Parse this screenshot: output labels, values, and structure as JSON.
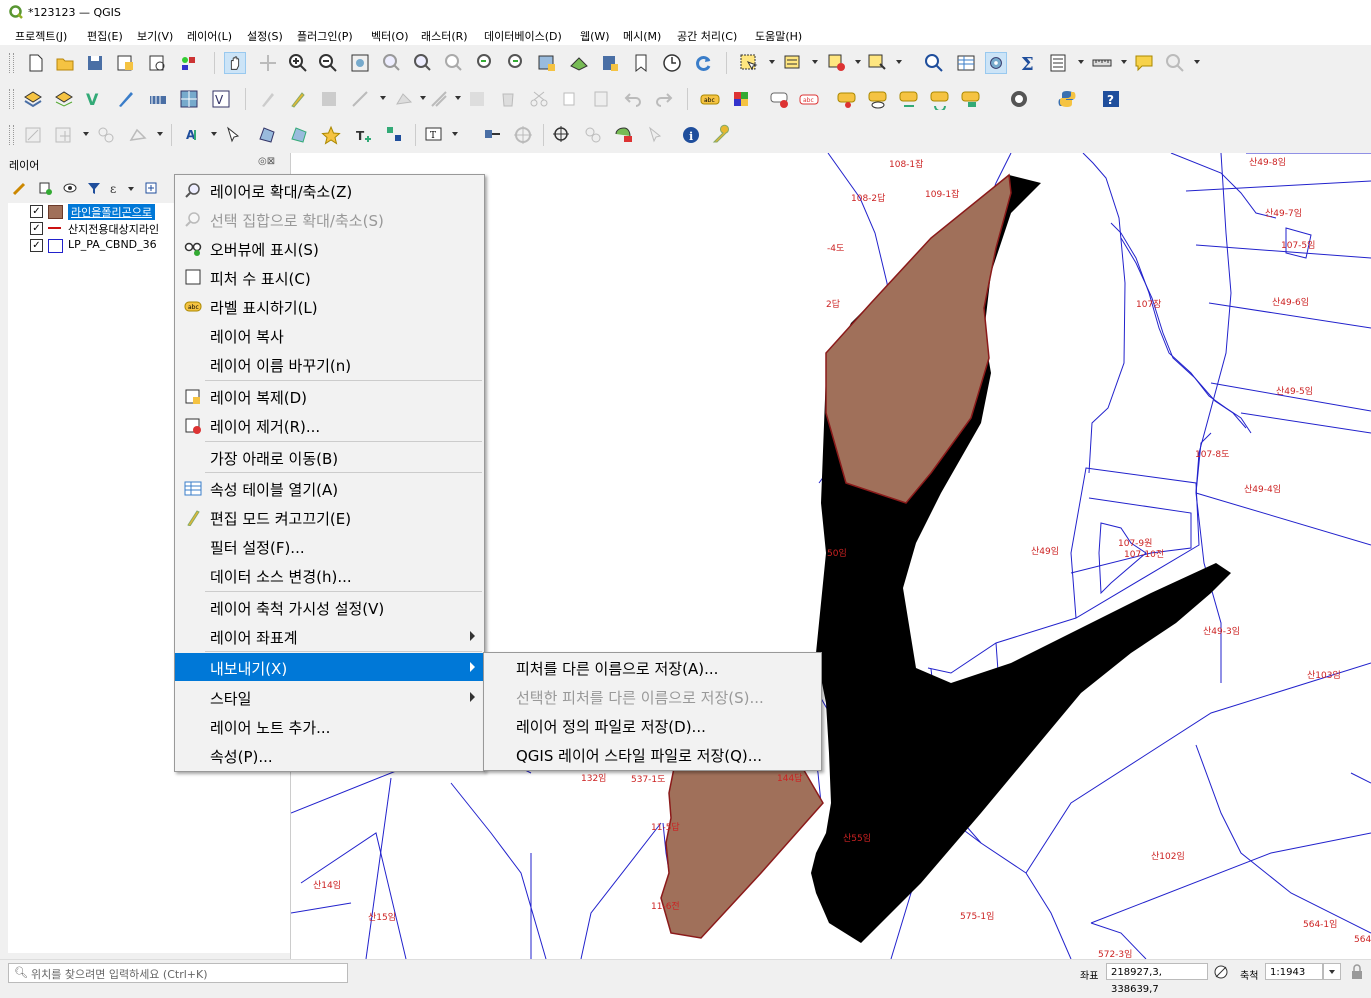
{
  "window": {
    "title": "*123123 — QGIS"
  },
  "menubar": [
    "프로젝트(J)",
    "편집(E)",
    "보기(V)",
    "레이어(L)",
    "설정(S)",
    "플러그인(P)",
    "벡터(O)",
    "래스터(R)",
    "데이터베이스(D)",
    "웹(W)",
    "메시(M)",
    "공간 처리(C)",
    "도움말(H)"
  ],
  "layers_panel": {
    "title": "레이어",
    "buttons": "◎⊠",
    "layers": [
      {
        "name": "라인을폴리곤으로",
        "checked": "✓",
        "symbol": "fill",
        "color": "#a0705a",
        "selected": true
      },
      {
        "name": "산지전용대상지라인",
        "checked": "✓",
        "symbol": "line",
        "color": "#cc1111",
        "selected": false
      },
      {
        "name": "LP_PA_CBND_36",
        "checked": "✓",
        "symbol": "outline",
        "color": "#2222cc",
        "selected": false
      }
    ]
  },
  "context_menu": {
    "items": [
      {
        "label": "레이어로 확대/축소(Z)",
        "icon": "zoom-layer-icon",
        "disabled": false
      },
      {
        "label": "선택 집합으로 확대/축소(S)",
        "icon": "zoom-selection-icon",
        "disabled": true
      },
      {
        "label": "오버뷰에 표시(S)",
        "icon": "overview-icon",
        "disabled": false
      },
      {
        "label": "피처 수 표시(C)",
        "icon": "checkbox-icon",
        "disabled": false
      },
      {
        "label": "라벨 표시하기(L)",
        "icon": "label-icon",
        "disabled": false
      },
      {
        "label": "레이어 복사",
        "icon": "",
        "disabled": false
      },
      {
        "label": "레이어 이름 바꾸기(n)",
        "icon": "",
        "disabled": false
      },
      {
        "label": "레이어 복제(D)",
        "icon": "duplicate-layer-icon",
        "disabled": false
      },
      {
        "label": "레이어 제거(R)...",
        "icon": "remove-layer-icon",
        "disabled": false
      },
      {
        "label": "가장 아래로 이동(B)",
        "icon": "",
        "disabled": false
      },
      {
        "label": "속성 테이블 열기(A)",
        "icon": "attribute-table-icon",
        "disabled": false
      },
      {
        "label": "편집 모드 켜고끄기(E)",
        "icon": "pencil-icon",
        "disabled": false
      },
      {
        "label": "필터 설정(F)...",
        "icon": "",
        "disabled": false
      },
      {
        "label": "데이터 소스 변경(h)...",
        "icon": "",
        "disabled": false
      },
      {
        "label": "레이어 축척 가시성 설정(V)",
        "icon": "",
        "disabled": false
      },
      {
        "label": "레이어 좌표계",
        "icon": "",
        "disabled": false,
        "submenu": true
      },
      {
        "label": "내보내기(X)",
        "icon": "",
        "disabled": false,
        "submenu": true,
        "highlighted": true
      },
      {
        "label": "스타일",
        "icon": "",
        "disabled": false,
        "submenu": true
      },
      {
        "label": "레이어 노트 추가...",
        "icon": "",
        "disabled": false
      },
      {
        "label": "속성(P)...",
        "icon": "",
        "disabled": false
      }
    ]
  },
  "export_submenu": {
    "items": [
      {
        "label": "피처를 다른 이름으로 저장(A)...",
        "disabled": false
      },
      {
        "label": "선택한 피처를 다른 이름으로 저장(S)...",
        "disabled": true
      },
      {
        "label": "레이어 정의 파일로 저장(D)...",
        "disabled": false
      },
      {
        "label": "QGIS 레이어 스타일 파일로 저장(Q)...",
        "disabled": false
      }
    ]
  },
  "map": {
    "parcel_labels": [
      "108-1잡",
      "108-2답",
      "109-1잡",
      "-4도",
      "2답",
      "107장",
      "산49-8임",
      "산49-7임",
      "107-5임",
      "산49-6임",
      "산49-5임",
      "107-8도",
      "산49-4임",
      "50임",
      "산49임",
      "107-9원",
      "107-10전",
      "산49-3임",
      "산103임",
      "산55임",
      "산102임",
      "산14임",
      "산15임",
      "575-1임",
      "572-3임",
      "564-1임",
      "564",
      "132임",
      "537-1도",
      "144답",
      "11-5답",
      "11-6전"
    ],
    "colors": {
      "parcel_line": "#2222cc",
      "label": "#cc2222",
      "polygon_fill": "#a0705a",
      "polygon_edge": "#8b1a1a"
    }
  },
  "statusbar": {
    "locator_placeholder": "위치를 찾으려면 입력하세요 (Ctrl+K)",
    "coord_label": "좌표",
    "coord_value": "218927,3, 338639,7",
    "scale_label": "축척",
    "scale_value": "1:1943"
  }
}
